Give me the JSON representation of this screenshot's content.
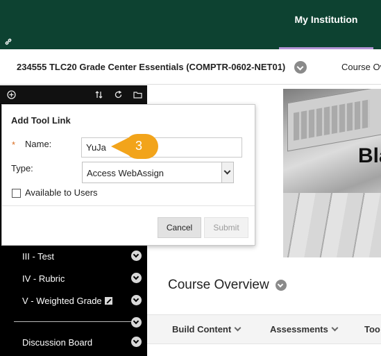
{
  "header": {
    "tab_label": "My Institution",
    "link_icon": "link-icon",
    "colors": {
      "bar": "#0d4231",
      "tab_underline": "#b394d6"
    }
  },
  "breadcrumb": {
    "course_title": "234555 TLC20 Grade Center Essentials (COMPTR-0602-NET01)",
    "current_page": "Course Ov"
  },
  "left_menu": {
    "tools": [
      "add-icon",
      "sort-icon",
      "refresh-icon",
      "folder-icon"
    ],
    "items": [
      {
        "label": "III - Test"
      },
      {
        "label": "IV - Rubric"
      },
      {
        "label": "V - Weighted Grade"
      },
      {
        "label": "Discussion Board"
      }
    ]
  },
  "hero": {
    "text": "Bla"
  },
  "content": {
    "title": "Course Overview",
    "actions": [
      {
        "label": "Build Content"
      },
      {
        "label": "Assessments"
      },
      {
        "label": "Too"
      }
    ]
  },
  "dialog": {
    "title": "Add Tool Link",
    "required_marker": "*",
    "name_label": "Name:",
    "name_value": "YuJa",
    "type_label": "Type:",
    "type_value": "Access WebAssign",
    "available_label": "Available to Users",
    "available_checked": false,
    "cancel_label": "Cancel",
    "submit_label": "Submit"
  },
  "callout": {
    "number": "3",
    "color": "#f2a41b"
  }
}
